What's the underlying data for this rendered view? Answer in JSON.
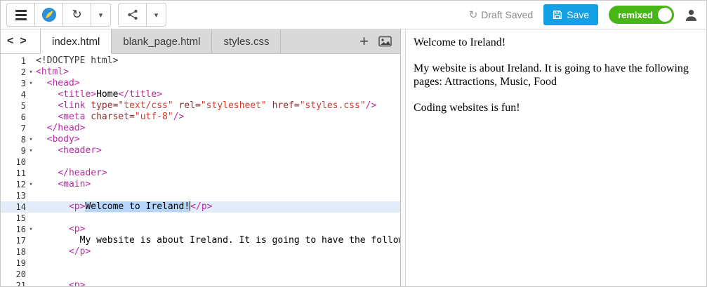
{
  "toolbar": {
    "draft_saved_label": "Draft Saved",
    "save_label": "Save",
    "remix_label": "remixed"
  },
  "icons": {
    "hamburger": "menu-bars",
    "refresh": "↻",
    "caret": "▾",
    "fold": "▾",
    "chevron_left": "<",
    "chevron_right": ">",
    "add_tab": "+"
  },
  "colors": {
    "save_button_blue": "#14a0e4",
    "remix_toggle_green": "#49b617",
    "selection_blue": "#b5d5fc",
    "active_line_blue": "#e3edf9",
    "syntax_tag": "#bb29a6",
    "syntax_attribute": "#8f2c2c",
    "syntax_string": "#d6382e"
  },
  "tabbar": {
    "tabs": [
      {
        "label": "index.html",
        "active": true
      },
      {
        "label": "blank_page.html",
        "active": false
      },
      {
        "label": "styles.css",
        "active": false
      }
    ]
  },
  "editor": {
    "lines": [
      {
        "n": 1,
        "seg": [
          [
            "meta",
            "<!DOCTYPE html>"
          ]
        ]
      },
      {
        "n": 2,
        "fold": true,
        "seg": [
          [
            "tag",
            "<html>"
          ]
        ]
      },
      {
        "n": 3,
        "fold": true,
        "seg": [
          [
            "text",
            "  "
          ],
          [
            "tag",
            "<head>"
          ]
        ]
      },
      {
        "n": 4,
        "seg": [
          [
            "text",
            "    "
          ],
          [
            "tag",
            "<title>"
          ],
          [
            "text",
            "Home"
          ],
          [
            "tag",
            "</title>"
          ]
        ]
      },
      {
        "n": 5,
        "seg": [
          [
            "text",
            "    "
          ],
          [
            "tag",
            "<link "
          ],
          [
            "attr",
            "type="
          ],
          [
            "str",
            "\"text/css\""
          ],
          [
            "text",
            " "
          ],
          [
            "attr",
            "rel="
          ],
          [
            "str",
            "\"stylesheet\""
          ],
          [
            "text",
            " "
          ],
          [
            "attr",
            "href="
          ],
          [
            "str",
            "\"styles.css\""
          ],
          [
            "tag",
            "/>"
          ]
        ]
      },
      {
        "n": 6,
        "seg": [
          [
            "text",
            "    "
          ],
          [
            "tag",
            "<meta "
          ],
          [
            "attr",
            "charset="
          ],
          [
            "str",
            "\"utf-8\""
          ],
          [
            "tag",
            "/>"
          ]
        ]
      },
      {
        "n": 7,
        "seg": [
          [
            "text",
            "  "
          ],
          [
            "tag",
            "</head>"
          ]
        ]
      },
      {
        "n": 8,
        "fold": true,
        "seg": [
          [
            "text",
            "  "
          ],
          [
            "tag",
            "<body>"
          ]
        ]
      },
      {
        "n": 9,
        "fold": true,
        "seg": [
          [
            "text",
            "    "
          ],
          [
            "tag",
            "<header>"
          ]
        ]
      },
      {
        "n": 10,
        "seg": []
      },
      {
        "n": 11,
        "seg": [
          [
            "text",
            "    "
          ],
          [
            "tag",
            "</header>"
          ]
        ]
      },
      {
        "n": 12,
        "fold": true,
        "seg": [
          [
            "text",
            "    "
          ],
          [
            "tag",
            "<main>"
          ]
        ]
      },
      {
        "n": 13,
        "seg": []
      },
      {
        "n": 14,
        "active": true,
        "seg": [
          [
            "text",
            "      "
          ],
          [
            "tag",
            "<p>"
          ],
          [
            "sel",
            "Welcome to Ireland!"
          ],
          [
            "cursor",
            ""
          ],
          [
            "tag",
            "</p>"
          ]
        ]
      },
      {
        "n": 15,
        "seg": []
      },
      {
        "n": 16,
        "fold": true,
        "seg": [
          [
            "text",
            "      "
          ],
          [
            "tag",
            "<p>"
          ]
        ]
      },
      {
        "n": 17,
        "seg": [
          [
            "text",
            "        My website is about Ireland. It is going to have the following"
          ]
        ]
      },
      {
        "n": 18,
        "seg": [
          [
            "text",
            "      "
          ],
          [
            "tag",
            "</p>"
          ]
        ]
      },
      {
        "n": 19,
        "seg": []
      },
      {
        "n": 20,
        "seg": []
      },
      {
        "n": 21,
        "seg": [
          [
            "text",
            "      "
          ],
          [
            "tag",
            "<p>"
          ]
        ]
      }
    ]
  },
  "preview": {
    "paragraphs": [
      "Welcome to Ireland!",
      "My website is about Ireland. It is going to have the following pages: Attractions, Music, Food",
      "Coding websites is fun!"
    ]
  }
}
